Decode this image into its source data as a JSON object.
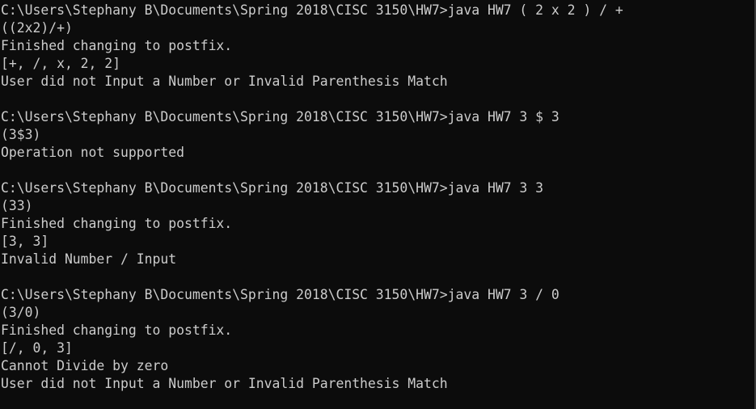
{
  "console": {
    "lines": [
      "C:\\Users\\Stephany B\\Documents\\Spring 2018\\CISC 3150\\HW7>java HW7 ( 2 x 2 ) / +",
      "((2x2)/+)",
      "Finished changing to postfix.",
      "[+, /, x, 2, 2]",
      "User did not Input a Number or Invalid Parenthesis Match",
      "",
      "C:\\Users\\Stephany B\\Documents\\Spring 2018\\CISC 3150\\HW7>java HW7 3 $ 3",
      "(3$3)",
      "Operation not supported",
      "",
      "C:\\Users\\Stephany B\\Documents\\Spring 2018\\CISC 3150\\HW7>java HW7 3 3",
      "(33)",
      "Finished changing to postfix.",
      "[3, 3]",
      "Invalid Number / Input",
      "",
      "C:\\Users\\Stephany B\\Documents\\Spring 2018\\CISC 3150\\HW7>java HW7 3 / 0",
      "(3/0)",
      "Finished changing to postfix.",
      "[/, 0, 3]",
      "Cannot Divide by zero",
      "User did not Input a Number or Invalid Parenthesis Match"
    ]
  },
  "colors": {
    "background": "#0c0c0c",
    "text": "#cccccc"
  }
}
